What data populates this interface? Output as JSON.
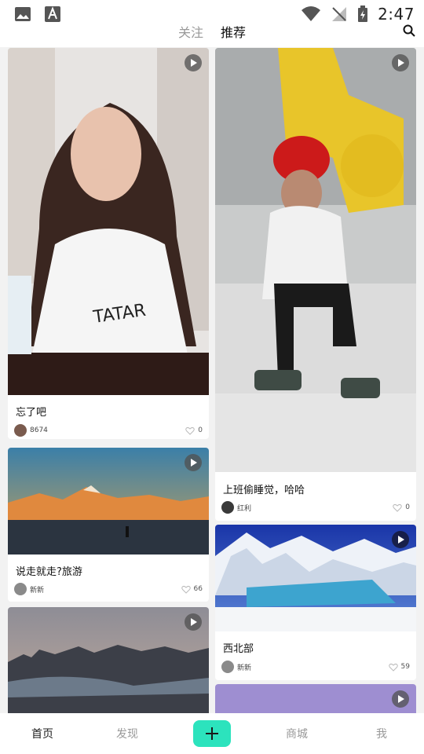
{
  "status_bar": {
    "time": "2:47"
  },
  "tabs": [
    {
      "label": "关注",
      "active": false
    },
    {
      "label": "推荐",
      "active": true
    }
  ],
  "feed": {
    "cards": [
      {
        "title": "忘了吧",
        "author": "8674",
        "likes": "0"
      },
      {
        "title": "说走就走?旅游",
        "author": "新新",
        "likes": "66"
      },
      {
        "title": "",
        "author": "",
        "likes": ""
      },
      {
        "title": "上班偷睡觉，哈哈",
        "author": "红利",
        "likes": "0"
      },
      {
        "title": "西北部",
        "author": "新新",
        "likes": "59"
      },
      {
        "title": "",
        "author": "",
        "likes": ""
      }
    ]
  },
  "bottom_nav": {
    "home": "首页",
    "discover": "发现",
    "mall": "商城",
    "me": "我"
  },
  "colors": {
    "accent": "#2ce3bd"
  }
}
